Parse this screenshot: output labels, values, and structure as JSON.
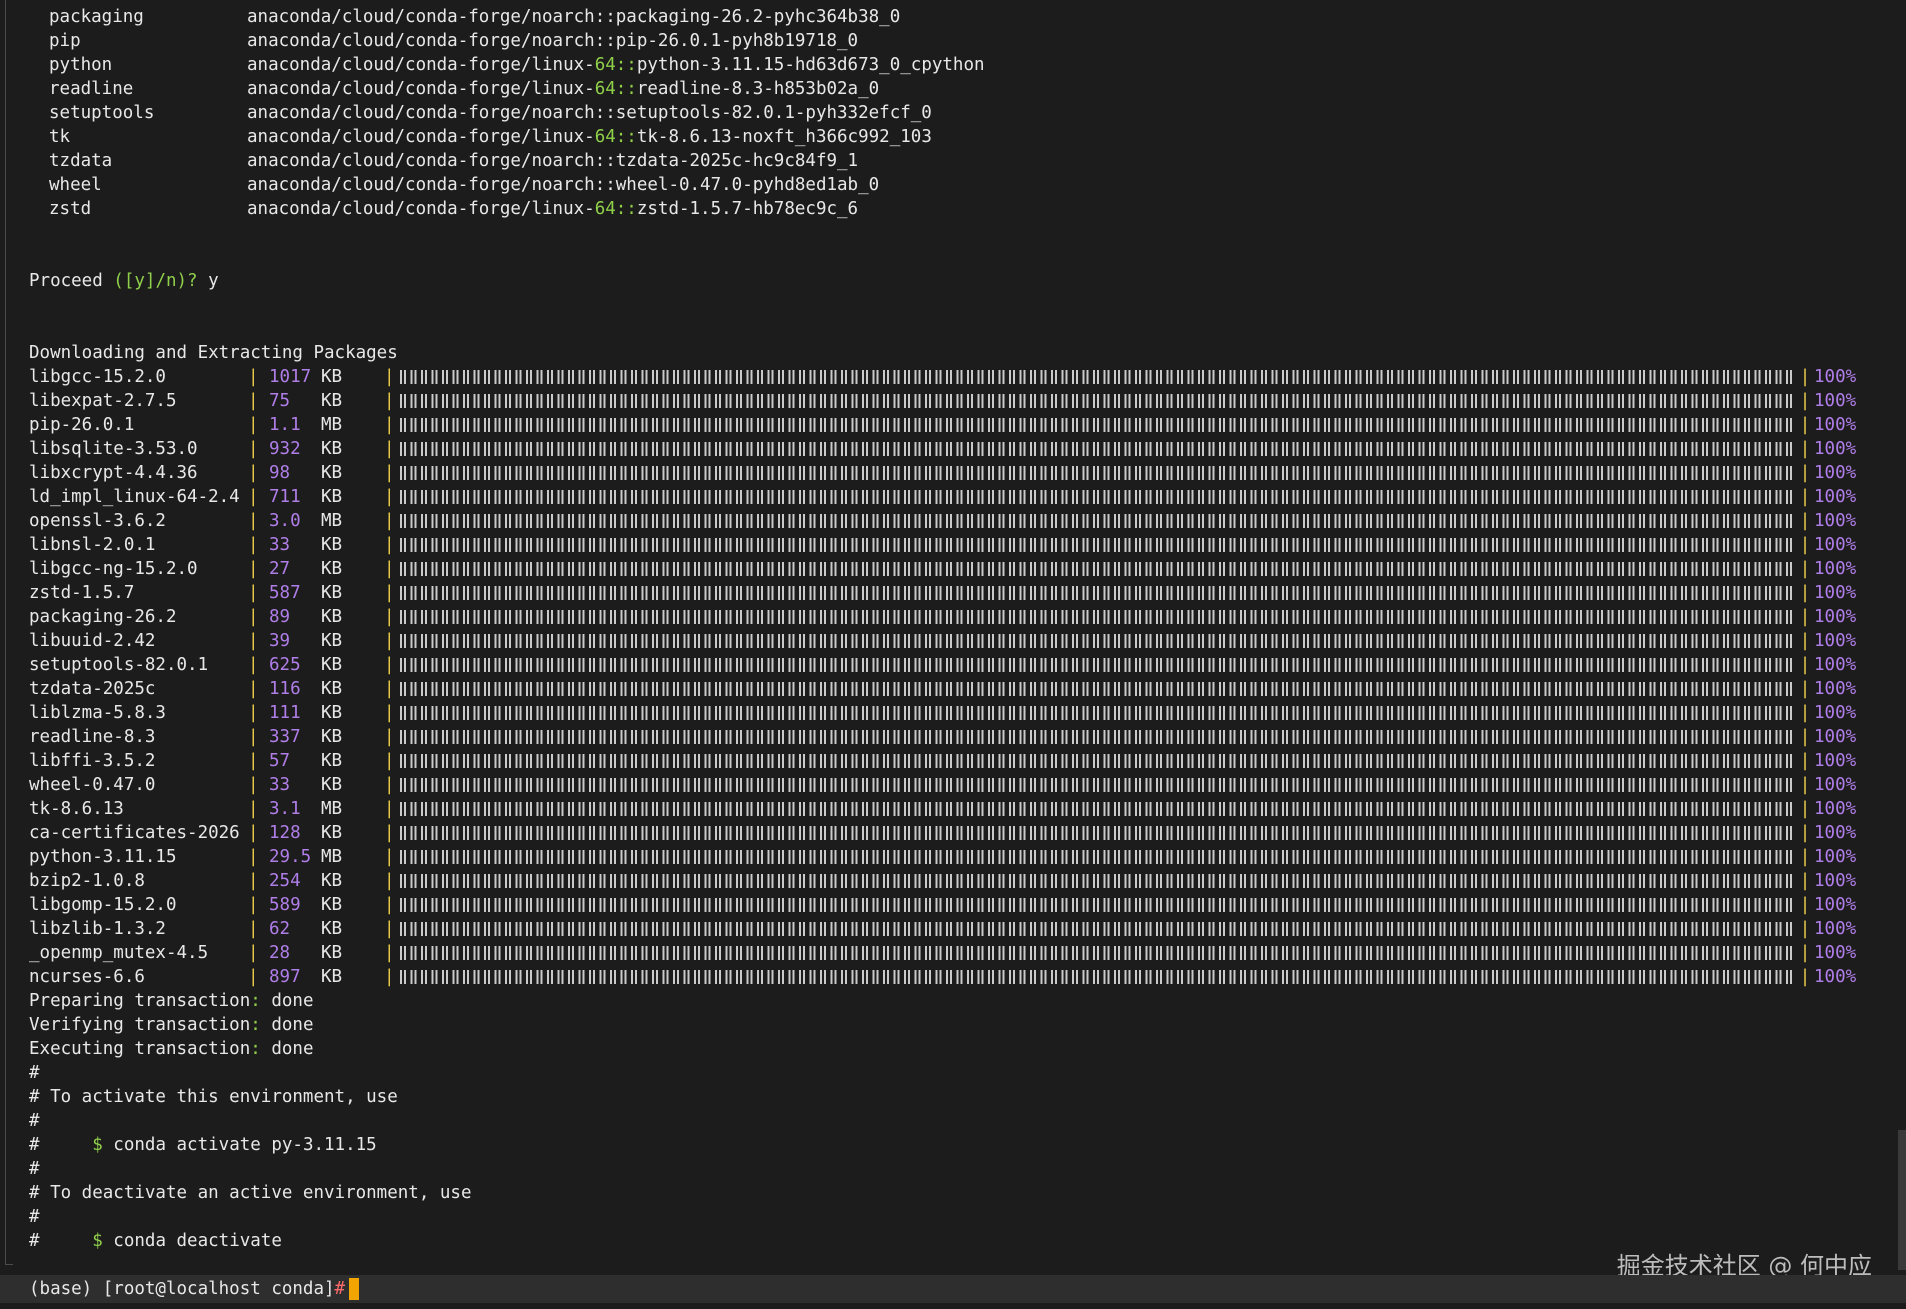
{
  "packages": [
    {
      "name": "packaging",
      "p1": "anaconda/cloud/conda-forge/noarch",
      "arch": "",
      "p2": "::packaging-26.2-pyhc364b38_0"
    },
    {
      "name": "pip",
      "p1": "anaconda/cloud/conda-forge/noarch",
      "arch": "",
      "p2": "::pip-26.0.1-pyh8b19718_0"
    },
    {
      "name": "python",
      "p1": "anaconda/cloud/conda-forge/linux-",
      "arch": "64::",
      "p2": "python-3.11.15-hd63d673_0_cpython"
    },
    {
      "name": "readline",
      "p1": "anaconda/cloud/conda-forge/linux-",
      "arch": "64::",
      "p2": "readline-8.3-h853b02a_0"
    },
    {
      "name": "setuptools",
      "p1": "anaconda/cloud/conda-forge/noarch",
      "arch": "",
      "p2": "::setuptools-82.0.1-pyh332efcf_0"
    },
    {
      "name": "tk",
      "p1": "anaconda/cloud/conda-forge/linux-",
      "arch": "64::",
      "p2": "tk-8.6.13-noxft_h366c992_103"
    },
    {
      "name": "tzdata",
      "p1": "anaconda/cloud/conda-forge/noarch",
      "arch": "",
      "p2": "::tzdata-2025c-hc9c84f9_1"
    },
    {
      "name": "wheel",
      "p1": "anaconda/cloud/conda-forge/noarch",
      "arch": "",
      "p2": "::wheel-0.47.0-pyhd8ed1ab_0"
    },
    {
      "name": "zstd",
      "p1": "anaconda/cloud/conda-forge/linux-",
      "arch": "64::",
      "p2": "zstd-1.5.7-hb78ec9c_6"
    }
  ],
  "proceed": {
    "text": "Proceed ",
    "options": "([y]/n)?",
    "answer": " y"
  },
  "downloading_header": "Downloading and Extracting Packages",
  "downloads": [
    {
      "name": "libgcc-15.2.0",
      "size": "1017",
      "unit": "KB",
      "progress": 100,
      "pct": "100%"
    },
    {
      "name": "libexpat-2.7.5",
      "size": "75",
      "unit": "KB",
      "progress": 100,
      "pct": "100%"
    },
    {
      "name": "pip-26.0.1",
      "size": "1.1",
      "unit": "MB",
      "progress": 100,
      "pct": "100%"
    },
    {
      "name": "libsqlite-3.53.0",
      "size": "932",
      "unit": "KB",
      "progress": 100,
      "pct": "100%"
    },
    {
      "name": "libxcrypt-4.4.36",
      "size": "98",
      "unit": "KB",
      "progress": 100,
      "pct": "100%"
    },
    {
      "name": "ld_impl_linux-64-2.4",
      "size": "711",
      "unit": "KB",
      "progress": 100,
      "pct": "100%"
    },
    {
      "name": "openssl-3.6.2",
      "size": "3.0",
      "unit": "MB",
      "progress": 100,
      "pct": "100%"
    },
    {
      "name": "libnsl-2.0.1",
      "size": "33",
      "unit": "KB",
      "progress": 100,
      "pct": "100%"
    },
    {
      "name": "libgcc-ng-15.2.0",
      "size": "27",
      "unit": "KB",
      "progress": 100,
      "pct": "100%"
    },
    {
      "name": "zstd-1.5.7",
      "size": "587",
      "unit": "KB",
      "progress": 100,
      "pct": "100%"
    },
    {
      "name": "packaging-26.2",
      "size": "89",
      "unit": "KB",
      "progress": 100,
      "pct": "100%"
    },
    {
      "name": "libuuid-2.42",
      "size": "39",
      "unit": "KB",
      "progress": 100,
      "pct": "100%"
    },
    {
      "name": "setuptools-82.0.1",
      "size": "625",
      "unit": "KB",
      "progress": 100,
      "pct": "100%"
    },
    {
      "name": "tzdata-2025c",
      "size": "116",
      "unit": "KB",
      "progress": 100,
      "pct": "100%"
    },
    {
      "name": "liblzma-5.8.3",
      "size": "111",
      "unit": "KB",
      "progress": 100,
      "pct": "100%"
    },
    {
      "name": "readline-8.3",
      "size": "337",
      "unit": "KB",
      "progress": 100,
      "pct": "100%"
    },
    {
      "name": "libffi-3.5.2",
      "size": "57",
      "unit": "KB",
      "progress": 100,
      "pct": "100%"
    },
    {
      "name": "wheel-0.47.0",
      "size": "33",
      "unit": "KB",
      "progress": 100,
      "pct": "100%"
    },
    {
      "name": "tk-8.6.13",
      "size": "3.1",
      "unit": "MB",
      "progress": 100,
      "pct": "100%"
    },
    {
      "name": "ca-certificates-2026",
      "size": "128",
      "unit": "KB",
      "progress": 100,
      "pct": "100%"
    },
    {
      "name": "python-3.11.15",
      "size": "29.5",
      "unit": "MB",
      "progress": 100,
      "pct": "100%"
    },
    {
      "name": "bzip2-1.0.8",
      "size": "254",
      "unit": "KB",
      "progress": 100,
      "pct": "100%"
    },
    {
      "name": "libgomp-15.2.0",
      "size": "589",
      "unit": "KB",
      "progress": 100,
      "pct": "100%"
    },
    {
      "name": "libzlib-1.3.2",
      "size": "62",
      "unit": "KB",
      "progress": 100,
      "pct": "100%"
    },
    {
      "name": "_openmp_mutex-4.5",
      "size": "28",
      "unit": "KB",
      "progress": 100,
      "pct": "100%"
    },
    {
      "name": "ncurses-6.6",
      "size": "897",
      "unit": "KB",
      "progress": 100,
      "pct": "100%"
    }
  ],
  "transactions": [
    {
      "label": "Preparing transaction",
      "status": "done"
    },
    {
      "label": "Verifying transaction",
      "status": "done"
    },
    {
      "label": "Executing transaction",
      "status": "done"
    }
  ],
  "comments": [
    {
      "text": "#",
      "cmd": ""
    },
    {
      "text": "# To activate this environment, use",
      "cmd": ""
    },
    {
      "text": "#",
      "cmd": ""
    },
    {
      "text": "#     ",
      "cmd": "$ conda activate py-3.11.15"
    },
    {
      "text": "#",
      "cmd": ""
    },
    {
      "text": "# To deactivate an active environment, use",
      "cmd": ""
    },
    {
      "text": "#",
      "cmd": ""
    },
    {
      "text": "#     ",
      "cmd": "$ conda deactivate"
    }
  ],
  "prompt": {
    "text": "(base) [root@localhost conda]",
    "symbol": "#"
  },
  "watermark": "掘金技术社区 @ 何中应",
  "colors": {
    "background": "#1c1c1c",
    "text": "#e8e8e8",
    "green": "#8fcf4a",
    "purple": "#b07ee8",
    "yellow_separator": "#e8c84a",
    "cursor": "#f2a500",
    "prompt_symbol": "#ff6b6b"
  }
}
